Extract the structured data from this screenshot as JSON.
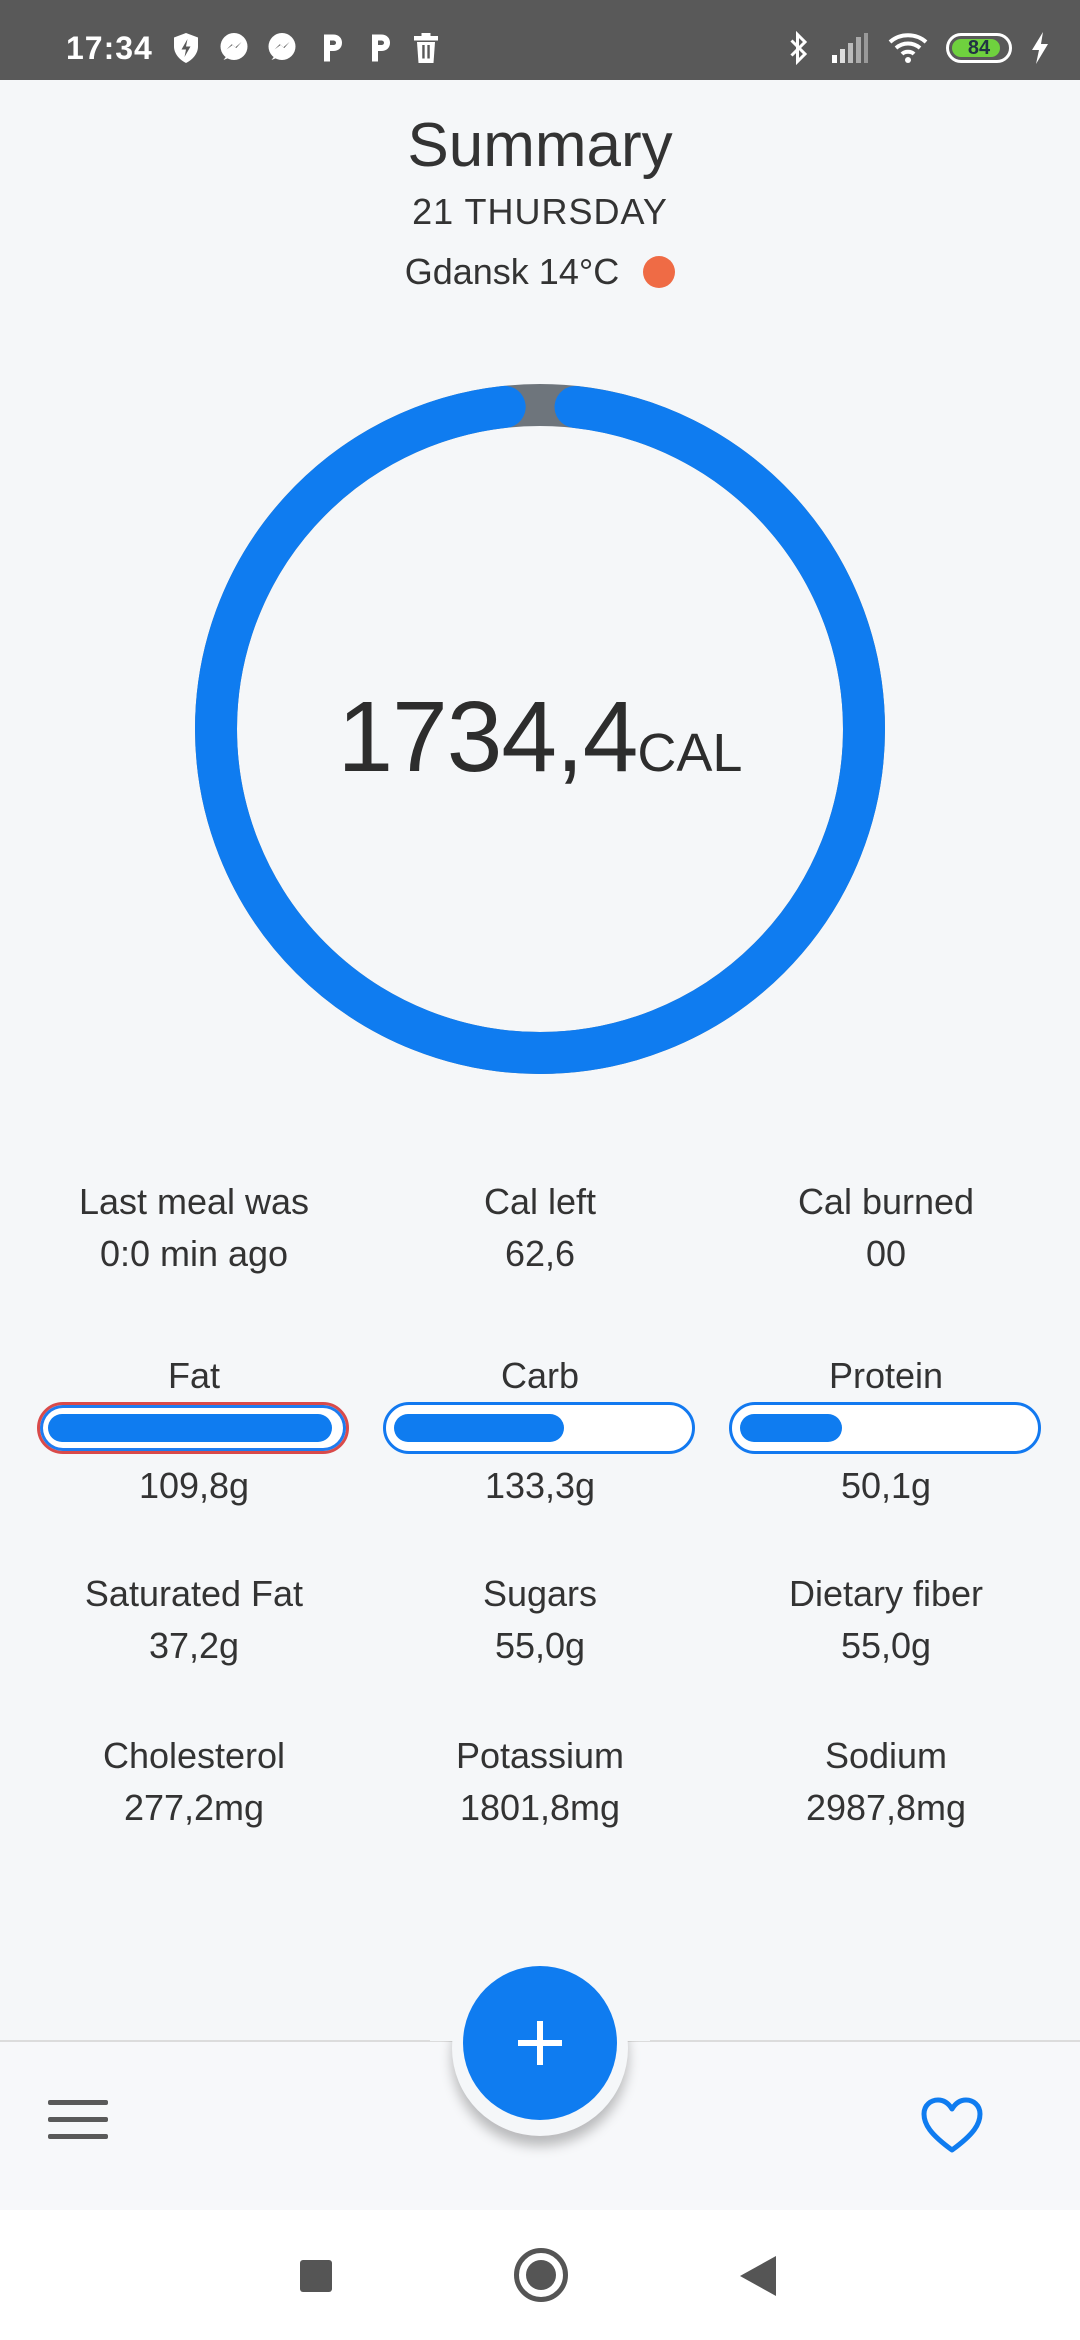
{
  "status_bar": {
    "time": "17:34",
    "battery": "84",
    "icons_left": [
      "shield-icon",
      "messenger-icon",
      "messenger-icon",
      "p-icon",
      "p-icon",
      "trash-icon"
    ],
    "icons_right": [
      "bluetooth-icon",
      "signal-icon",
      "wifi-icon",
      "battery-icon",
      "charging-icon"
    ]
  },
  "header": {
    "title": "Summary",
    "date": "21 THURSDAY",
    "weather": "Gdansk 14°C",
    "weather_dot_color": "#ef6b45"
  },
  "calories": {
    "value": "1734,4",
    "unit": "CAL",
    "ring_fraction": 0.965,
    "ring_color": "#0f7cf0",
    "gap_color": "#6e757c"
  },
  "stats": [
    {
      "label": "Last meal was",
      "value": "0:0 min ago"
    },
    {
      "label": "Cal left",
      "value": "62,6"
    },
    {
      "label": "Cal burned",
      "value": "00"
    }
  ],
  "macros": [
    {
      "label": "Fat",
      "value": "109,8g",
      "fraction": 1.0,
      "over": true
    },
    {
      "label": "Carb",
      "value": "133,3g",
      "fraction": 0.6
    },
    {
      "label": "Protein",
      "value": "50,1g",
      "fraction": 0.36
    }
  ],
  "nutrients_row1": [
    {
      "label": "Saturated Fat",
      "value": "37,2g"
    },
    {
      "label": "Sugars",
      "value": "55,0g"
    },
    {
      "label": "Dietary fiber",
      "value": "55,0g"
    }
  ],
  "nutrients_row2": [
    {
      "label": "Cholesterol",
      "value": "277,2mg"
    },
    {
      "label": "Potassium",
      "value": "1801,8mg"
    },
    {
      "label": "Sodium",
      "value": "2987,8mg"
    }
  ],
  "bottom_bar": {
    "menu_icon": "menu-icon",
    "fab_icon": "plus-icon",
    "favorite_icon": "heart-icon",
    "accent": "#0f7cf0"
  }
}
